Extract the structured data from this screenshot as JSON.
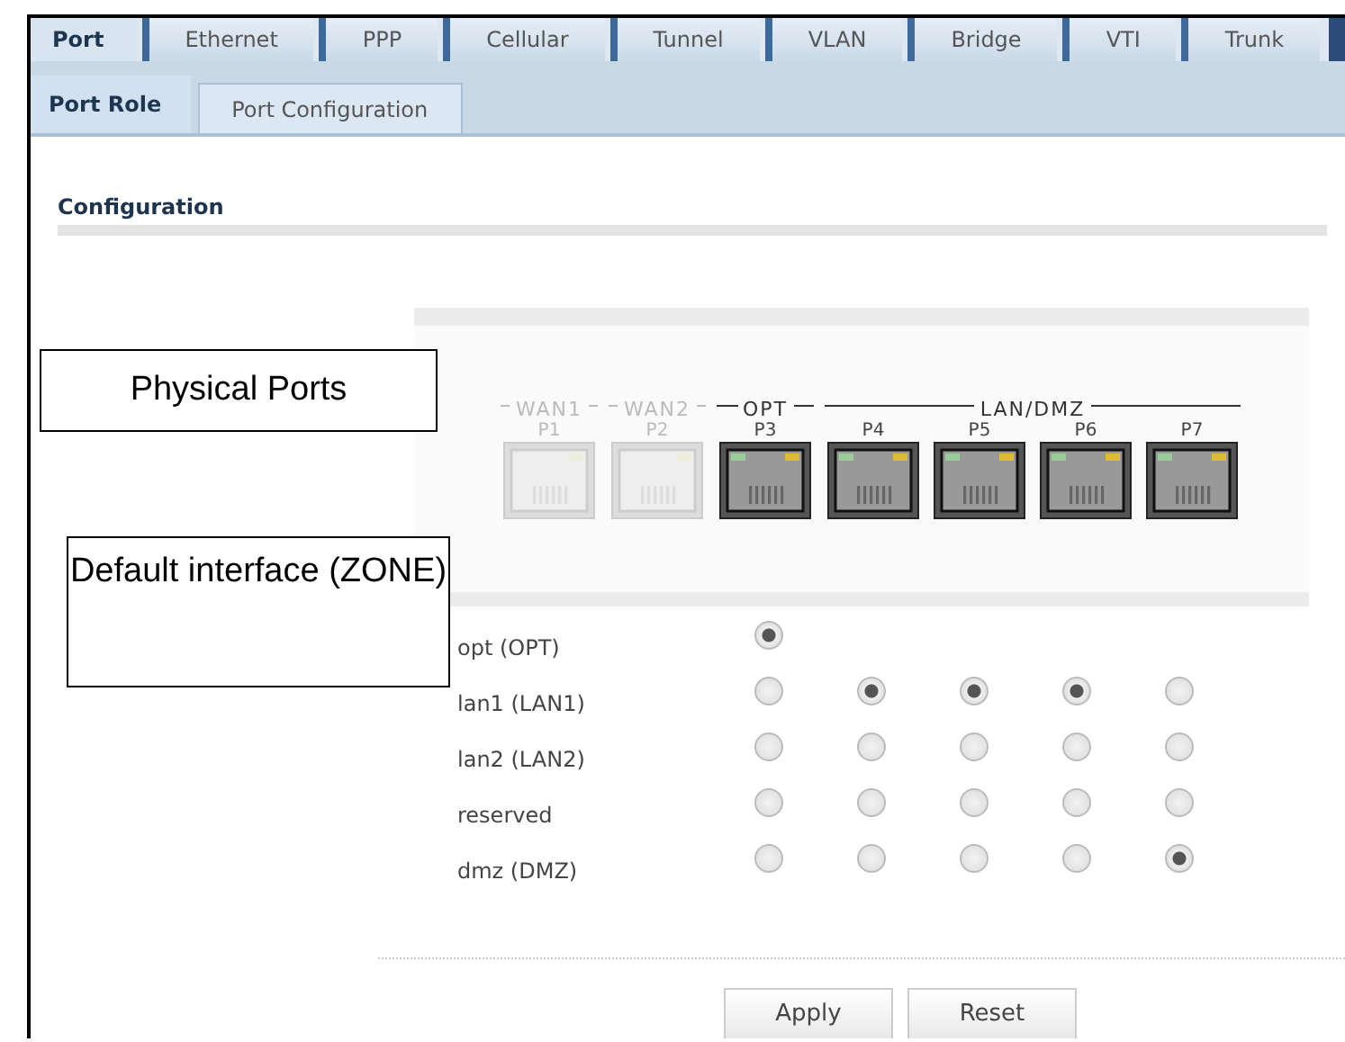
{
  "tabs": [
    {
      "label": "Port",
      "selected": true
    },
    {
      "label": "Ethernet",
      "selected": false
    },
    {
      "label": "PPP",
      "selected": false
    },
    {
      "label": "Cellular",
      "selected": false
    },
    {
      "label": "Tunnel",
      "selected": false
    },
    {
      "label": "VLAN",
      "selected": false
    },
    {
      "label": "Bridge",
      "selected": false
    },
    {
      "label": "VTI",
      "selected": false
    },
    {
      "label": "Trunk",
      "selected": false
    }
  ],
  "subtabs": [
    {
      "label": "Port Role",
      "selected": true
    },
    {
      "label": "Port Configuration",
      "selected": false
    }
  ],
  "section_title": "Configuration",
  "port_groups": [
    {
      "label": "WAN1",
      "enabled": false,
      "ports": [
        "P1"
      ]
    },
    {
      "label": "WAN2",
      "enabled": false,
      "ports": [
        "P2"
      ]
    },
    {
      "label": "OPT",
      "enabled": true,
      "ports": [
        "P3"
      ]
    },
    {
      "label": "LAN/DMZ",
      "enabled": true,
      "ports": [
        "P4",
        "P5",
        "P6",
        "P7"
      ]
    }
  ],
  "interfaces": [
    {
      "label": "opt (OPT)",
      "radios": [
        {
          "selected": true
        }
      ]
    },
    {
      "label": "lan1 (LAN1)",
      "radios": [
        {
          "selected": false
        },
        {
          "selected": true
        },
        {
          "selected": true
        },
        {
          "selected": true
        },
        {
          "selected": false
        }
      ]
    },
    {
      "label": "lan2 (LAN2)",
      "radios": [
        {
          "selected": false
        },
        {
          "selected": false
        },
        {
          "selected": false
        },
        {
          "selected": false
        },
        {
          "selected": false
        }
      ]
    },
    {
      "label": "reserved",
      "radios": [
        {
          "selected": false
        },
        {
          "selected": false
        },
        {
          "selected": false
        },
        {
          "selected": false
        },
        {
          "selected": false
        }
      ]
    },
    {
      "label": "dmz (DMZ)",
      "radios": [
        {
          "selected": false
        },
        {
          "selected": false
        },
        {
          "selected": false
        },
        {
          "selected": false
        },
        {
          "selected": true
        }
      ]
    }
  ],
  "buttons": [
    "Apply",
    "Reset"
  ],
  "callouts": [
    "Physical Ports",
    "Default interface (ZONE)"
  ]
}
